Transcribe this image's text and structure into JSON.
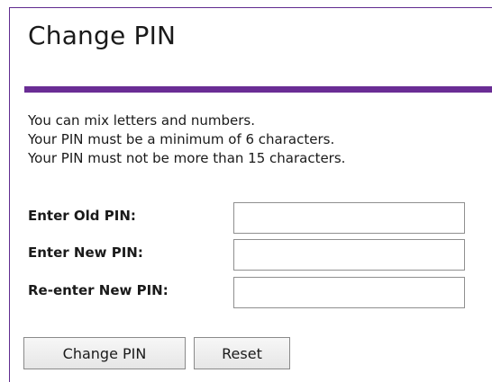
{
  "page": {
    "title": "Change PIN"
  },
  "instructions": [
    "You can mix letters and numbers.",
    "Your PIN must be a minimum of 6 characters.",
    "Your PIN must not be more than 15 characters."
  ],
  "form": {
    "old_pin": {
      "label": "Enter Old PIN:",
      "value": ""
    },
    "new_pin": {
      "label": "Enter New PIN:",
      "value": ""
    },
    "confirm_pin": {
      "label": "Re-enter New PIN:",
      "value": ""
    }
  },
  "buttons": {
    "submit_label": "Change PIN",
    "reset_label": "Reset"
  },
  "colors": {
    "accent": "#6a2d95",
    "border": "#5f2b8f"
  }
}
